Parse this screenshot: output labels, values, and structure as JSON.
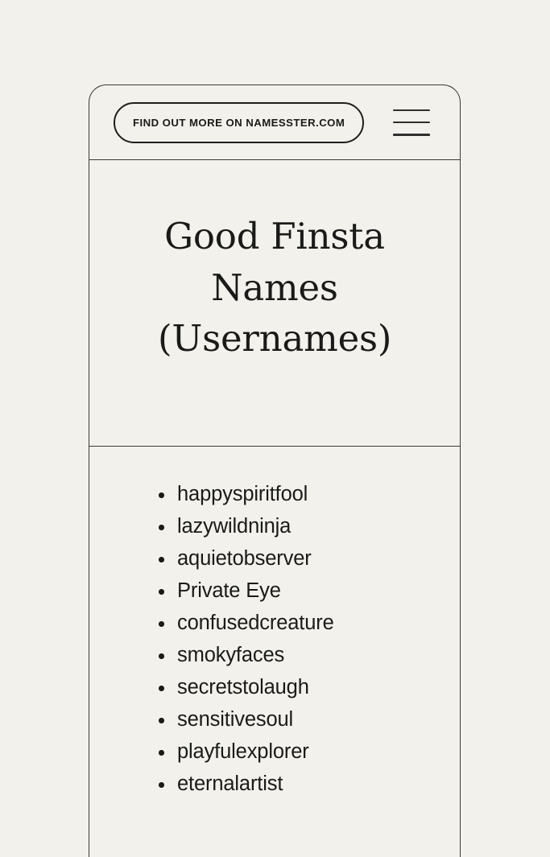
{
  "page": {
    "background_color": "#F2F1EC",
    "text_color": "#1A1A18",
    "border_color": "#3A3A38"
  },
  "header": {
    "cta_label": "FIND OUT MORE ON NAMESSTER.COM",
    "menu_icon": "hamburger-menu-icon"
  },
  "title": {
    "line1": "Good Finsta",
    "line2": "Names",
    "line3": "(Usernames)",
    "full": "Good Finsta Names (Usernames)"
  },
  "list": {
    "items": [
      {
        "label": "happyspiritfool"
      },
      {
        "label": "lazywildninja"
      },
      {
        "label": "aquietobserver"
      },
      {
        "label": "Private Eye"
      },
      {
        "label": "confusedcreature"
      },
      {
        "label": "smokyfaces"
      },
      {
        "label": "secretstolaugh"
      },
      {
        "label": "sensitivesoul"
      },
      {
        "label": "playfulexplorer"
      },
      {
        "label": "eternalartist"
      }
    ]
  }
}
